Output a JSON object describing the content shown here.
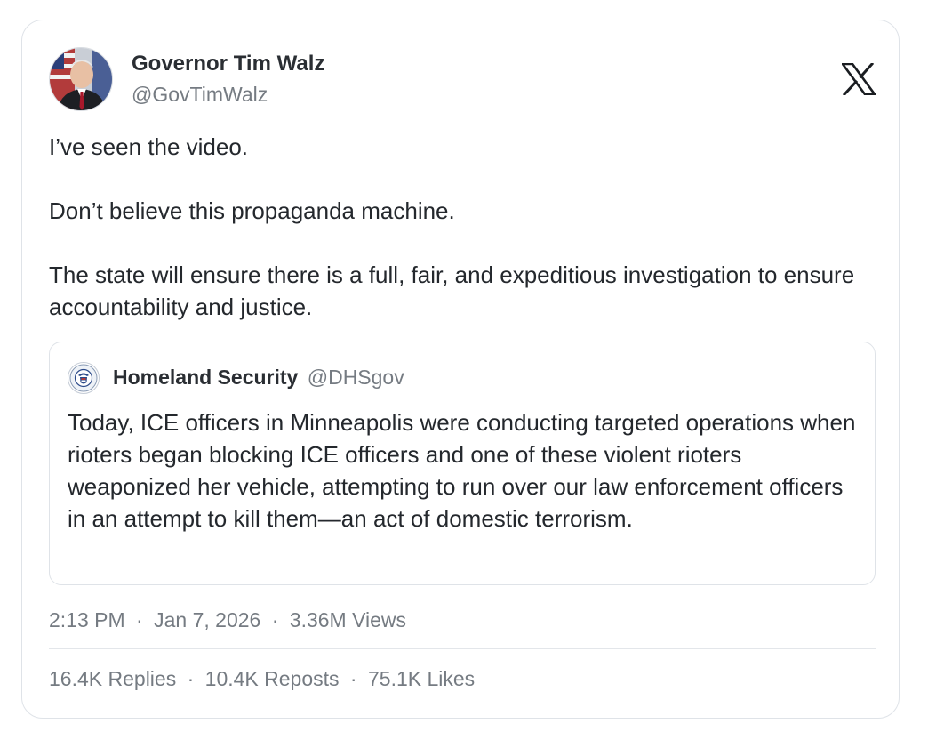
{
  "author": {
    "name": "Governor Tim Walz",
    "handle": "@GovTimWalz",
    "avatar_icon": "profile-photo-avatar"
  },
  "platform_icon": "x-logo-icon",
  "tweet": {
    "paragraphs": [
      "I’ve seen the video.",
      "Don’t believe this propaganda machine.",
      "The state will ensure there is a full, fair, and expeditious investigation to ensure accountability and justice."
    ]
  },
  "quoted": {
    "name": "Homeland Security",
    "handle": "@DHSgov",
    "avatar_icon": "dhs-seal-icon",
    "text": "Today, ICE officers in Minneapolis were conducting targeted operations when rioters began blocking ICE officers and one of these violent rioters weaponized her vehicle, attempting to run over our law enforcement officers in an attempt to kill them—an act of domestic terrorism."
  },
  "meta": {
    "time": "2:13 PM",
    "date": "Jan 7, 2026",
    "views": "3.36M Views",
    "separator": "·"
  },
  "stats": {
    "replies": "16.4K Replies",
    "reposts": "10.4K Reposts",
    "likes": "75.1K Likes",
    "separator": "·"
  },
  "colors": {
    "text_primary": "#24282d",
    "text_secondary": "#757b82",
    "border": "#dfe3e8"
  }
}
